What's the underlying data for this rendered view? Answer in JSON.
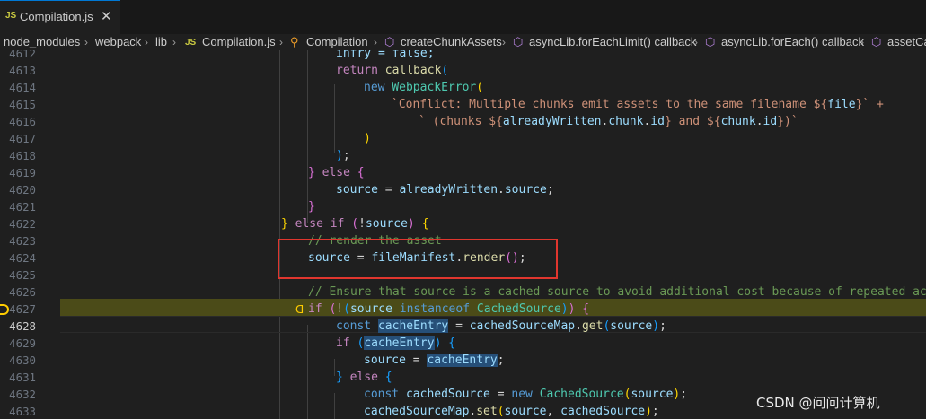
{
  "tab": {
    "badge": "JS",
    "title": "Compilation.js",
    "close": "✕"
  },
  "breadcrumb": {
    "items": [
      "node_modules",
      "webpack",
      "lib",
      "Compilation.js",
      "Compilation",
      "createChunkAssets",
      "asyncLib.forEachLimit() callback",
      "asyncLib.forEach() callback",
      "assetCa"
    ],
    "separator": "›",
    "file_badge": "JS"
  },
  "line_numbers": [
    "4612",
    "4613",
    "4614",
    "4615",
    "4616",
    "4617",
    "4618",
    "4619",
    "4620",
    "4621",
    "4622",
    "4623",
    "4624",
    "4625",
    "4626",
    "4627",
    "4628",
    "4629",
    "4630",
    "4631",
    "4632",
    "4633"
  ],
  "code": {
    "l4612": "infry = false;",
    "l4613a": "return",
    "l4613b": "callback",
    "l4614a": "new",
    "l4614b": "WebpackError",
    "l4615a": "`Conflict: Multiple chunks emit assets to the same filename ${",
    "l4615b": "file",
    "l4615c": "}` +",
    "l4616a": "` (chunks ${",
    "l4616b": "alreadyWritten",
    "l4616c": "chunk",
    "l4616d": "id",
    "l4616e": "} and ${",
    "l4616f": "chunk",
    "l4616g": "id",
    "l4616h": "})`",
    "l4619a": "} else {",
    "l4620a": "source",
    "l4620b": "alreadyWritten",
    "l4620c": "source",
    "l4622a": "} else if (",
    "l4622b": "!source",
    "l4622c": ") {",
    "l4623": "// render the asset",
    "l4624a": "source",
    "l4624b": "fileManifest",
    "l4624c": "render",
    "l4626": "// Ensure that source is a cached source to avoid additional cost because of repeated access",
    "l4627a": "if",
    "l4627b": "source",
    "l4627c": "instanceof",
    "l4627d": "CachedSource",
    "l4628a": "const",
    "l4628b": "cacheEntry",
    "l4628c": "cachedSourceMap",
    "l4628d": "get",
    "l4628e": "source",
    "l4629a": "if",
    "l4629b": "cacheEntry",
    "l4630a": "source",
    "l4630b": "cacheEntry",
    "l4631": "} else {",
    "l4632a": "const",
    "l4632b": "cachedSource",
    "l4632c": "new",
    "l4632d": "CachedSource",
    "l4632e": "source",
    "l4633a": "cachedSourceMap",
    "l4633b": "set",
    "l4633c": "source",
    "l4633d": "cachedSource"
  },
  "current_line": "4628",
  "paused_line": "4627",
  "watermark": "CSDN @问问计算机",
  "colors": {
    "accent": "#0078d4",
    "annotation_box": "#e0362e",
    "paused_highlight": "#4b4b18"
  }
}
